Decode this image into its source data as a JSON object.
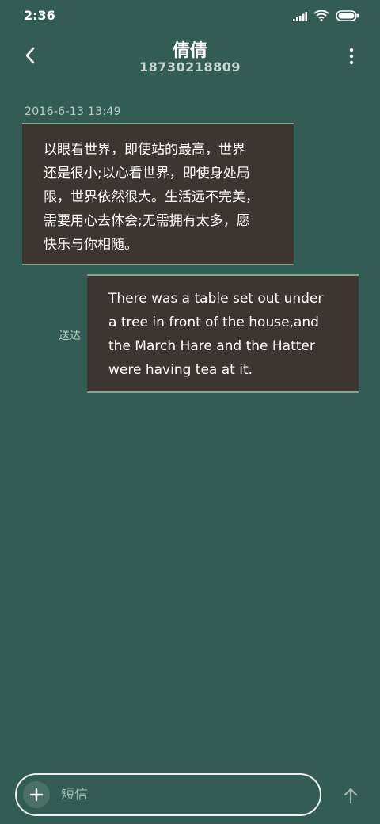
{
  "status_bar": {
    "time": "2:36",
    "icons": [
      "signal-icon",
      "wifi-icon",
      "battery-icon"
    ]
  },
  "header": {
    "contact_name": "倩倩",
    "contact_number": "18730218809",
    "back_icon": "chevron-left-icon",
    "menu_icon": "more-vertical-icon"
  },
  "conversation": {
    "timestamp": "2016-6-13 13:49",
    "messages": [
      {
        "direction": "incoming",
        "lines": [
          "以眼看世界，即使站的最高，世界",
          "还是很小;以心看世界，即使身处局",
          "限，世界依然很大。生活远不完美，",
          "需要用心去体会;无需拥有太多，愿",
          "快乐与你相随。"
        ]
      },
      {
        "direction": "outgoing",
        "lines": [
          "There was a table set out under",
          "a tree in front of the house,and",
          "the March Hare and the Hatter",
          "were having tea at it."
        ],
        "status": "送达"
      }
    ]
  },
  "composer": {
    "placeholder": "短信",
    "value": "",
    "attach_icon": "plus-icon",
    "send_icon": "arrow-up-icon"
  },
  "colors": {
    "background": "#335d54",
    "bubble": "#3c3532",
    "bubble_border": "#7fa58d",
    "secondary_text": "#b9ccc6"
  }
}
